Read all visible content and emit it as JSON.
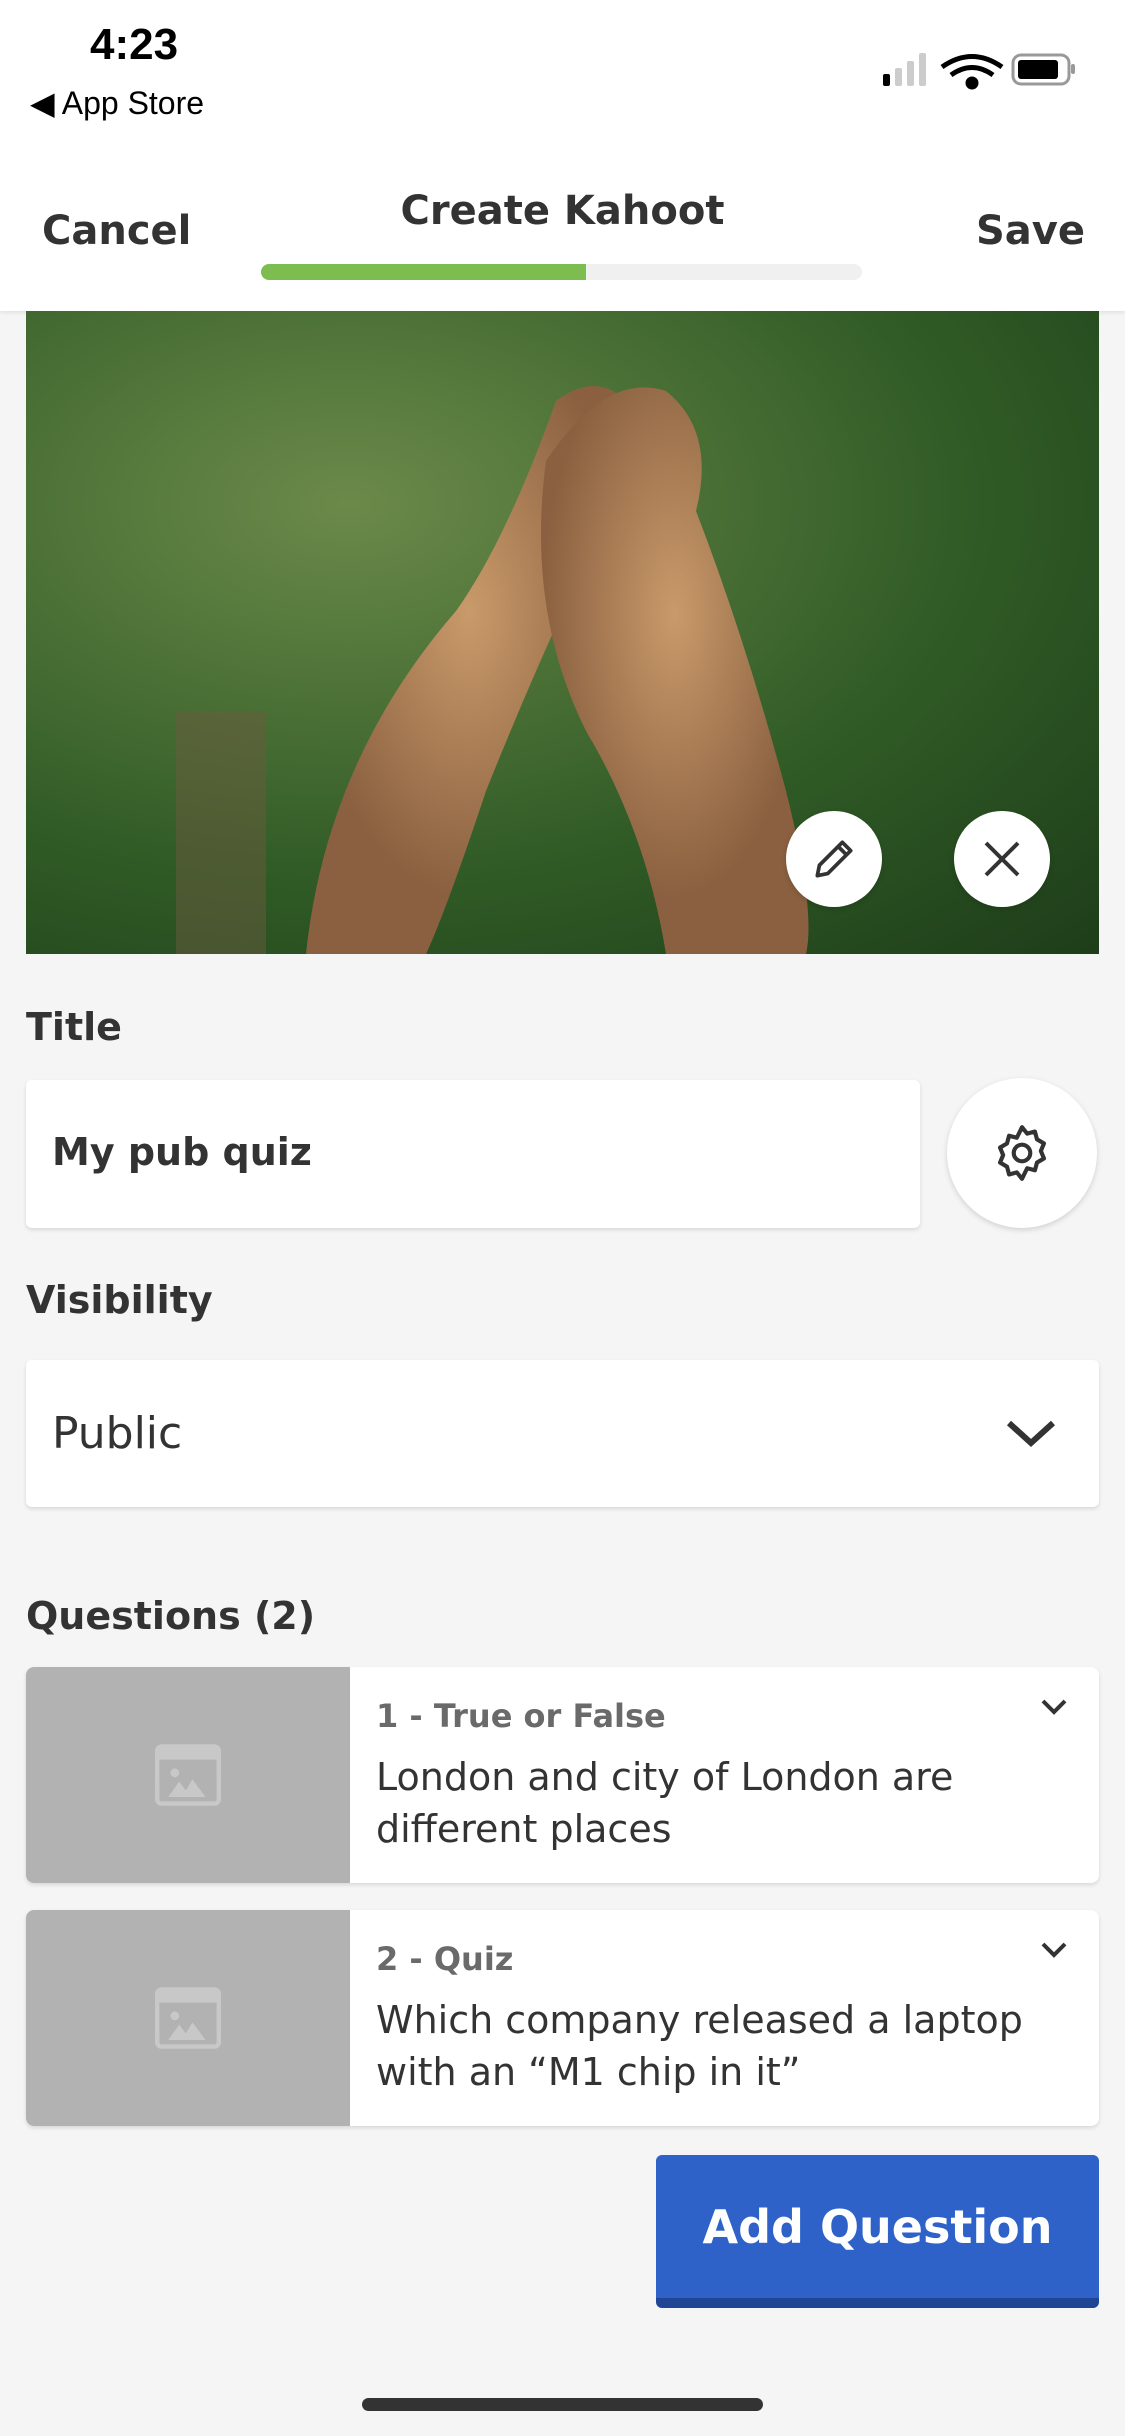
{
  "status_bar": {
    "time": "4:23",
    "back_label": "App Store"
  },
  "header": {
    "cancel_label": "Cancel",
    "title": "Create Kahoot",
    "save_label": "Save",
    "progress": 0.54
  },
  "cover": {
    "edit_icon": "pencil-icon",
    "remove_icon": "close-icon"
  },
  "form": {
    "title_label": "Title",
    "title_value": "My pub quiz",
    "visibility_label": "Visibility",
    "visibility_value": "Public"
  },
  "questions": {
    "heading": "Questions (2)",
    "items": [
      {
        "type": "1 - True or False",
        "text": "London and city of London are different places"
      },
      {
        "type": "2 - Quiz",
        "text": "Which company released a laptop with an “M1 chip in it”"
      }
    ]
  },
  "add_question_label": "Add Question",
  "colors": {
    "progress": "#7dbd4f",
    "primary": "#2f62c9"
  }
}
